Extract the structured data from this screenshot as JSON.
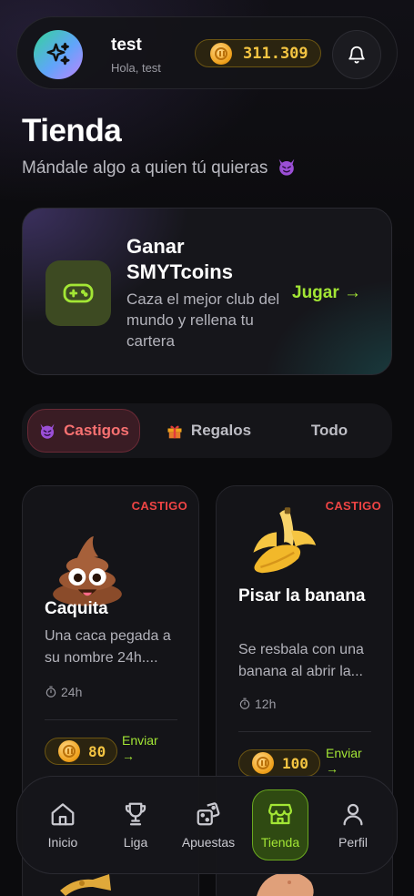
{
  "header": {
    "user_name": "test",
    "greeting": "Hola, test",
    "balance": "311.309",
    "avatar_icon": "sparkles-icon",
    "notification_icon": "bell-icon"
  },
  "page": {
    "title": "Tienda",
    "subtitle": "Mándale algo a quien tú quieras"
  },
  "promo": {
    "title": "Ganar SMYTcoins",
    "description": "Caza el mejor club del mundo y rellena tu cartera",
    "cta": "Jugar →",
    "icon": "gamepad-icon"
  },
  "tabs": [
    {
      "label": "Castigos",
      "icon": "devil-emoji",
      "active": true
    },
    {
      "label": "Regalos",
      "icon": "gift-emoji",
      "active": false
    },
    {
      "label": "Todo",
      "icon": "",
      "active": false
    }
  ],
  "products": [
    {
      "tag": "CASTIGO",
      "name": "Caquita",
      "description": "Una caca pegada a su nombre 24h....",
      "duration": "24h",
      "price": "80",
      "send_label": "Enviar →",
      "image": "poop-emoji"
    },
    {
      "tag": "CASTIGO",
      "name": "Pisar la banana",
      "description": "Se resbala con una banana al abrir la...",
      "duration": "12h",
      "price": "100",
      "send_label": "Enviar →",
      "image": "banana-emoji"
    }
  ],
  "nav": [
    {
      "label": "Inicio",
      "icon": "home-icon",
      "active": false
    },
    {
      "label": "Liga",
      "icon": "trophy-icon",
      "active": false
    },
    {
      "label": "Apuestas",
      "icon": "dice-icon",
      "active": false
    },
    {
      "label": "Tienda",
      "icon": "store-icon",
      "active": true
    },
    {
      "label": "Perfil",
      "icon": "user-icon",
      "active": false
    }
  ],
  "colors": {
    "accent_green": "#a3e635",
    "coin_gold": "#f5c542",
    "castigo_red": "#ef4444",
    "background": "#0b0b0d"
  }
}
